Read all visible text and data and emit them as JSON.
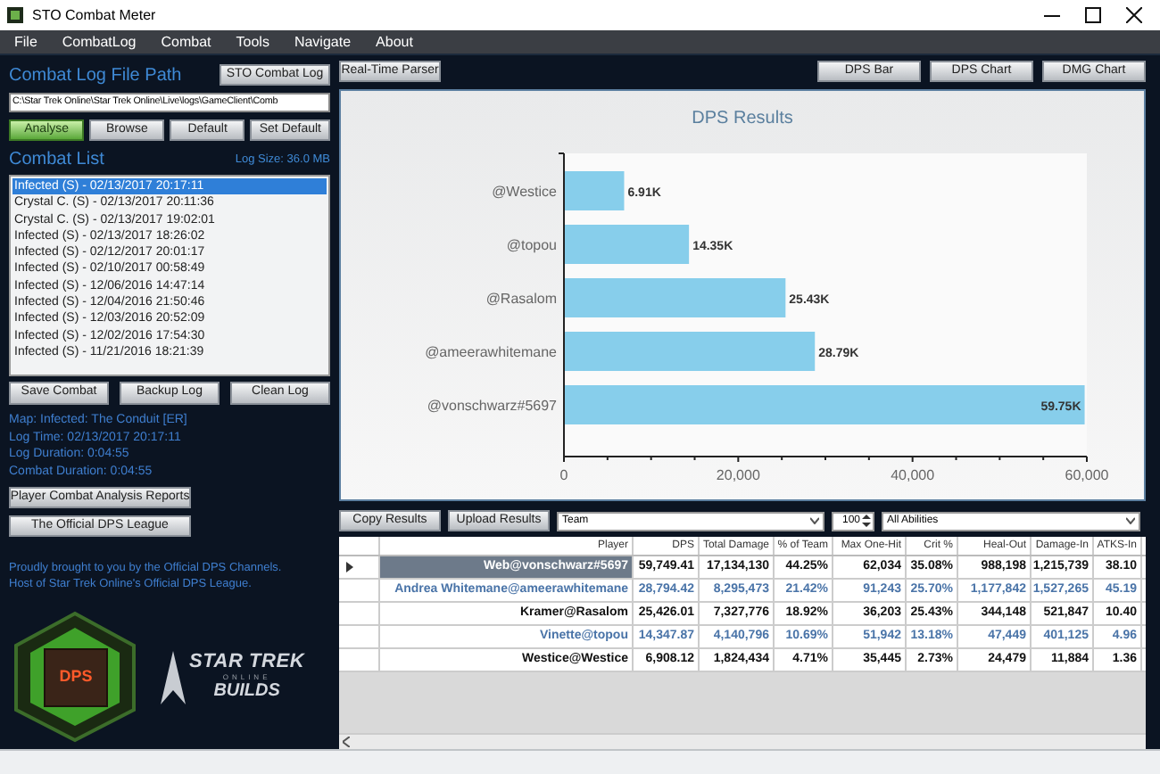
{
  "window": {
    "title": "STO Combat Meter"
  },
  "menu": [
    "File",
    "CombatLog",
    "Combat",
    "Tools",
    "Navigate",
    "About"
  ],
  "log_path": {
    "label": "Combat Log File Path",
    "button": "STO Combat Log",
    "value": "C:\\Star Trek Online\\Star Trek Online\\Live\\logs\\GameClient\\Comb"
  },
  "path_buttons": [
    {
      "label": "Analyse",
      "kind": "primary"
    },
    {
      "label": "Browse",
      "kind": "normal"
    },
    {
      "label": "Default",
      "kind": "normal"
    },
    {
      "label": "Set Default",
      "kind": "normal"
    }
  ],
  "combat_list": {
    "label": "Combat List",
    "log_size": "Log Size: 36.0 MB",
    "items": [
      {
        "label": "Infected (S) - 02/13/2017 20:17:11",
        "selected": true
      },
      {
        "label": "Crystal C. (S) - 02/13/2017 20:11:36",
        "selected": false
      },
      {
        "label": "Crystal C. (S) - 02/13/2017 19:02:01",
        "selected": false
      },
      {
        "label": "Infected (S) - 02/13/2017 18:26:02",
        "selected": false
      },
      {
        "label": "Infected (S) - 02/12/2017 20:01:17",
        "selected": false
      },
      {
        "label": "Infected (S) - 02/10/2017 00:58:49",
        "selected": false
      },
      {
        "label": "Infected (S) - 12/06/2016 14:47:14",
        "selected": false
      },
      {
        "label": "Infected (S) - 12/04/2016 21:50:46",
        "selected": false
      },
      {
        "label": "Infected (S) - 12/03/2016 20:52:09",
        "selected": false
      },
      {
        "label": "Infected (S) - 12/02/2016 17:54:30",
        "selected": false
      },
      {
        "label": "Infected (S) - 11/21/2016 18:21:39",
        "selected": false
      }
    ]
  },
  "log_buttons": [
    "Save Combat",
    "Backup Log",
    "Clean Log"
  ],
  "combat_info": [
    "Map: Infected: The Conduit [ER]",
    "Log Time: 02/13/2017 20:17:11",
    "Log Duration: 0:04:55",
    "Combat Duration: 0:04:55"
  ],
  "link_buttons": [
    "Player Combat Analysis Reports",
    "The Official DPS League"
  ],
  "credits": [
    "Proudly brought to you by the Official DPS Channels.",
    "Host of Star Trek Online's Official DPS League."
  ],
  "logos": {
    "dps": "DPS",
    "sto_title": "STAR TREK",
    "sto_sub": "ONLINE",
    "sto_builds": "BUILDS"
  },
  "parser_button": "Real-Time Parser",
  "view_buttons": [
    "DPS Bar",
    "DPS Chart",
    "DMG Chart"
  ],
  "chart": {
    "chart_data": {
      "type": "bar",
      "orientation": "horizontal",
      "title": "DPS Results",
      "categories": [
        "@Westice",
        "@topou",
        "@Rasalom",
        "@ameerawhitemane",
        "@vonschwarz#5697"
      ],
      "series": [
        {
          "color": "#87ceeb",
          "values": [
            6908,
            14348,
            25426,
            28794,
            59749
          ]
        }
      ],
      "xlim": [
        0,
        60000
      ],
      "xticks": [
        {
          "value": 0,
          "label": "0"
        },
        {
          "value": 20000,
          "label": "20,000"
        },
        {
          "value": 40000,
          "label": "40,000"
        },
        {
          "value": 60000,
          "label": "60,000"
        }
      ],
      "value_labels": [
        "6.91K",
        "14.35K",
        "25.43K",
        "28.79K",
        "59.75K"
      ]
    }
  },
  "results_toolbar": {
    "buttons": [
      "Copy Results",
      "Upload Results"
    ],
    "group": "Team",
    "count": "100",
    "abilities": "All Abilities"
  },
  "table": {
    "columns": [
      "Player",
      "DPS",
      "Total Damage",
      "% of Team",
      "Max One-Hit",
      "Crit %",
      "Heal-Out",
      "Damage-In",
      "ATKS-In"
    ],
    "rows": [
      {
        "selected": true,
        "cells": [
          "Web@vonschwarz#5697",
          "59,749.41",
          "17,134,130",
          "44.25%",
          "62,034",
          "35.08%",
          "988,198",
          "1,215,739",
          "38.10"
        ]
      },
      {
        "selected": false,
        "cells": [
          "Andrea Whitemane@ameerawhitemane",
          "28,794.42",
          "8,295,473",
          "21.42%",
          "91,243",
          "25.70%",
          "1,177,842",
          "1,527,265",
          "45.19"
        ]
      },
      {
        "selected": false,
        "cells": [
          "Kramer@Rasalom",
          "25,426.01",
          "7,327,776",
          "18.92%",
          "36,203",
          "25.43%",
          "344,148",
          "521,847",
          "10.40"
        ]
      },
      {
        "selected": false,
        "cells": [
          "Vinette@topou",
          "14,347.87",
          "4,140,796",
          "10.69%",
          "51,942",
          "13.18%",
          "47,449",
          "401,125",
          "4.96"
        ]
      },
      {
        "selected": false,
        "cells": [
          "Westice@Westice",
          "6,908.12",
          "1,824,434",
          "4.71%",
          "35,445",
          "2.73%",
          "24,479",
          "11,884",
          "1.36"
        ]
      }
    ]
  }
}
